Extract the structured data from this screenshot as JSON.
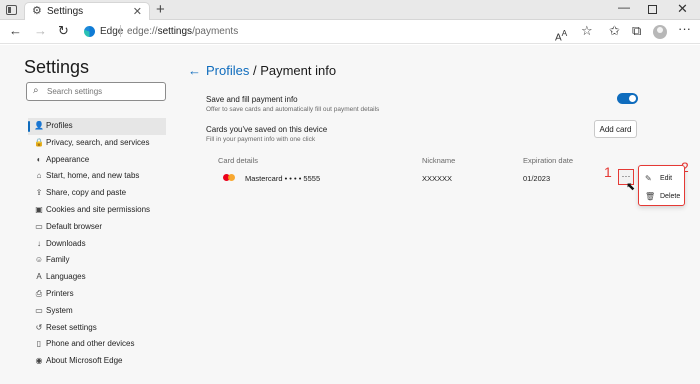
{
  "browser": {
    "tab_title": "Settings",
    "tab_close": "✕",
    "new_tab": "+",
    "url_brand": "Edge",
    "url_prefix": "edge://",
    "url_main": "settings",
    "url_suffix": "/payments",
    "icons": [
      "tabs-icon",
      "gear-icon",
      "back-icon",
      "forward-icon",
      "refresh-icon",
      "edge-logo-icon",
      "reader-icon",
      "star-icon",
      "favorites-icon",
      "collections-icon",
      "avatar",
      "more-icon"
    ]
  },
  "sidebar": {
    "title": "Settings",
    "search_placeholder": "Search settings",
    "items": [
      {
        "label": "Profiles",
        "icon": "👤",
        "active": true
      },
      {
        "label": "Privacy, search, and services",
        "icon": "🔒"
      },
      {
        "label": "Appearance",
        "icon": "◐"
      },
      {
        "label": "Start, home, and new tabs",
        "icon": "⌂"
      },
      {
        "label": "Share, copy and paste",
        "icon": "⇪"
      },
      {
        "label": "Cookies and site permissions",
        "icon": "▣"
      },
      {
        "label": "Default browser",
        "icon": "▭"
      },
      {
        "label": "Downloads",
        "icon": "↓"
      },
      {
        "label": "Family",
        "icon": "☺"
      },
      {
        "label": "Languages",
        "icon": "A"
      },
      {
        "label": "Printers",
        "icon": "⎙"
      },
      {
        "label": "System",
        "icon": "▭"
      },
      {
        "label": "Reset settings",
        "icon": "↺"
      },
      {
        "label": "Phone and other devices",
        "icon": "▯"
      },
      {
        "label": "About Microsoft Edge",
        "icon": "◉"
      }
    ]
  },
  "main": {
    "breadcrumb_link": "Profiles",
    "breadcrumb_sep": " / ",
    "page_title": "Payment info",
    "save_fill_title": "Save and fill payment info",
    "save_fill_desc": "Offer to save cards and automatically fill out payment details",
    "save_fill_enabled": true,
    "cards_title": "Cards you've saved on this device",
    "cards_desc": "Fill in your payment info with one click",
    "add_card_label": "Add card",
    "columns": [
      "Card details",
      "Nickname",
      "Expiration date"
    ],
    "card": {
      "name": "Mastercard • • • • 5555",
      "nickname": "XXXXXX",
      "expiration": "01/2023"
    },
    "more_label": "···",
    "context_menu": [
      {
        "label": "Edit",
        "icon": "✎"
      },
      {
        "label": "Delete",
        "icon": "🗑"
      }
    ]
  },
  "annotations": {
    "step1": "1",
    "step2": "2",
    "accent": "#e53935"
  }
}
